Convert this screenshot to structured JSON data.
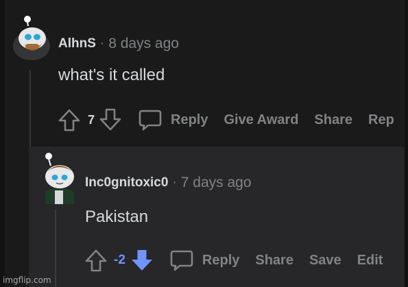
{
  "colors": {
    "background": "#1a1a1b",
    "reply_background": "#272729",
    "text": "#d7dadc",
    "muted": "#818384",
    "downvote_active": "#7193ff"
  },
  "comments": [
    {
      "username": "AlhnS",
      "separator": "·",
      "time": "8 days ago",
      "body": "what's it called",
      "score": "7",
      "vote_state": "none",
      "actions": [
        "Reply",
        "Give Award",
        "Share",
        "Rep"
      ],
      "icons": [
        "upvote-icon",
        "downvote-icon",
        "comment-bubble-icon"
      ]
    },
    {
      "username": "Inc0gnitoxic0",
      "separator": "·",
      "time": "7 days ago",
      "body": "Pakistan",
      "score": "-2",
      "vote_state": "downvoted",
      "actions": [
        "Reply",
        "Share",
        "Save",
        "Edit"
      ],
      "icons": [
        "upvote-icon",
        "downvote-icon",
        "comment-bubble-icon"
      ]
    }
  ],
  "watermark": "imgflip.com"
}
